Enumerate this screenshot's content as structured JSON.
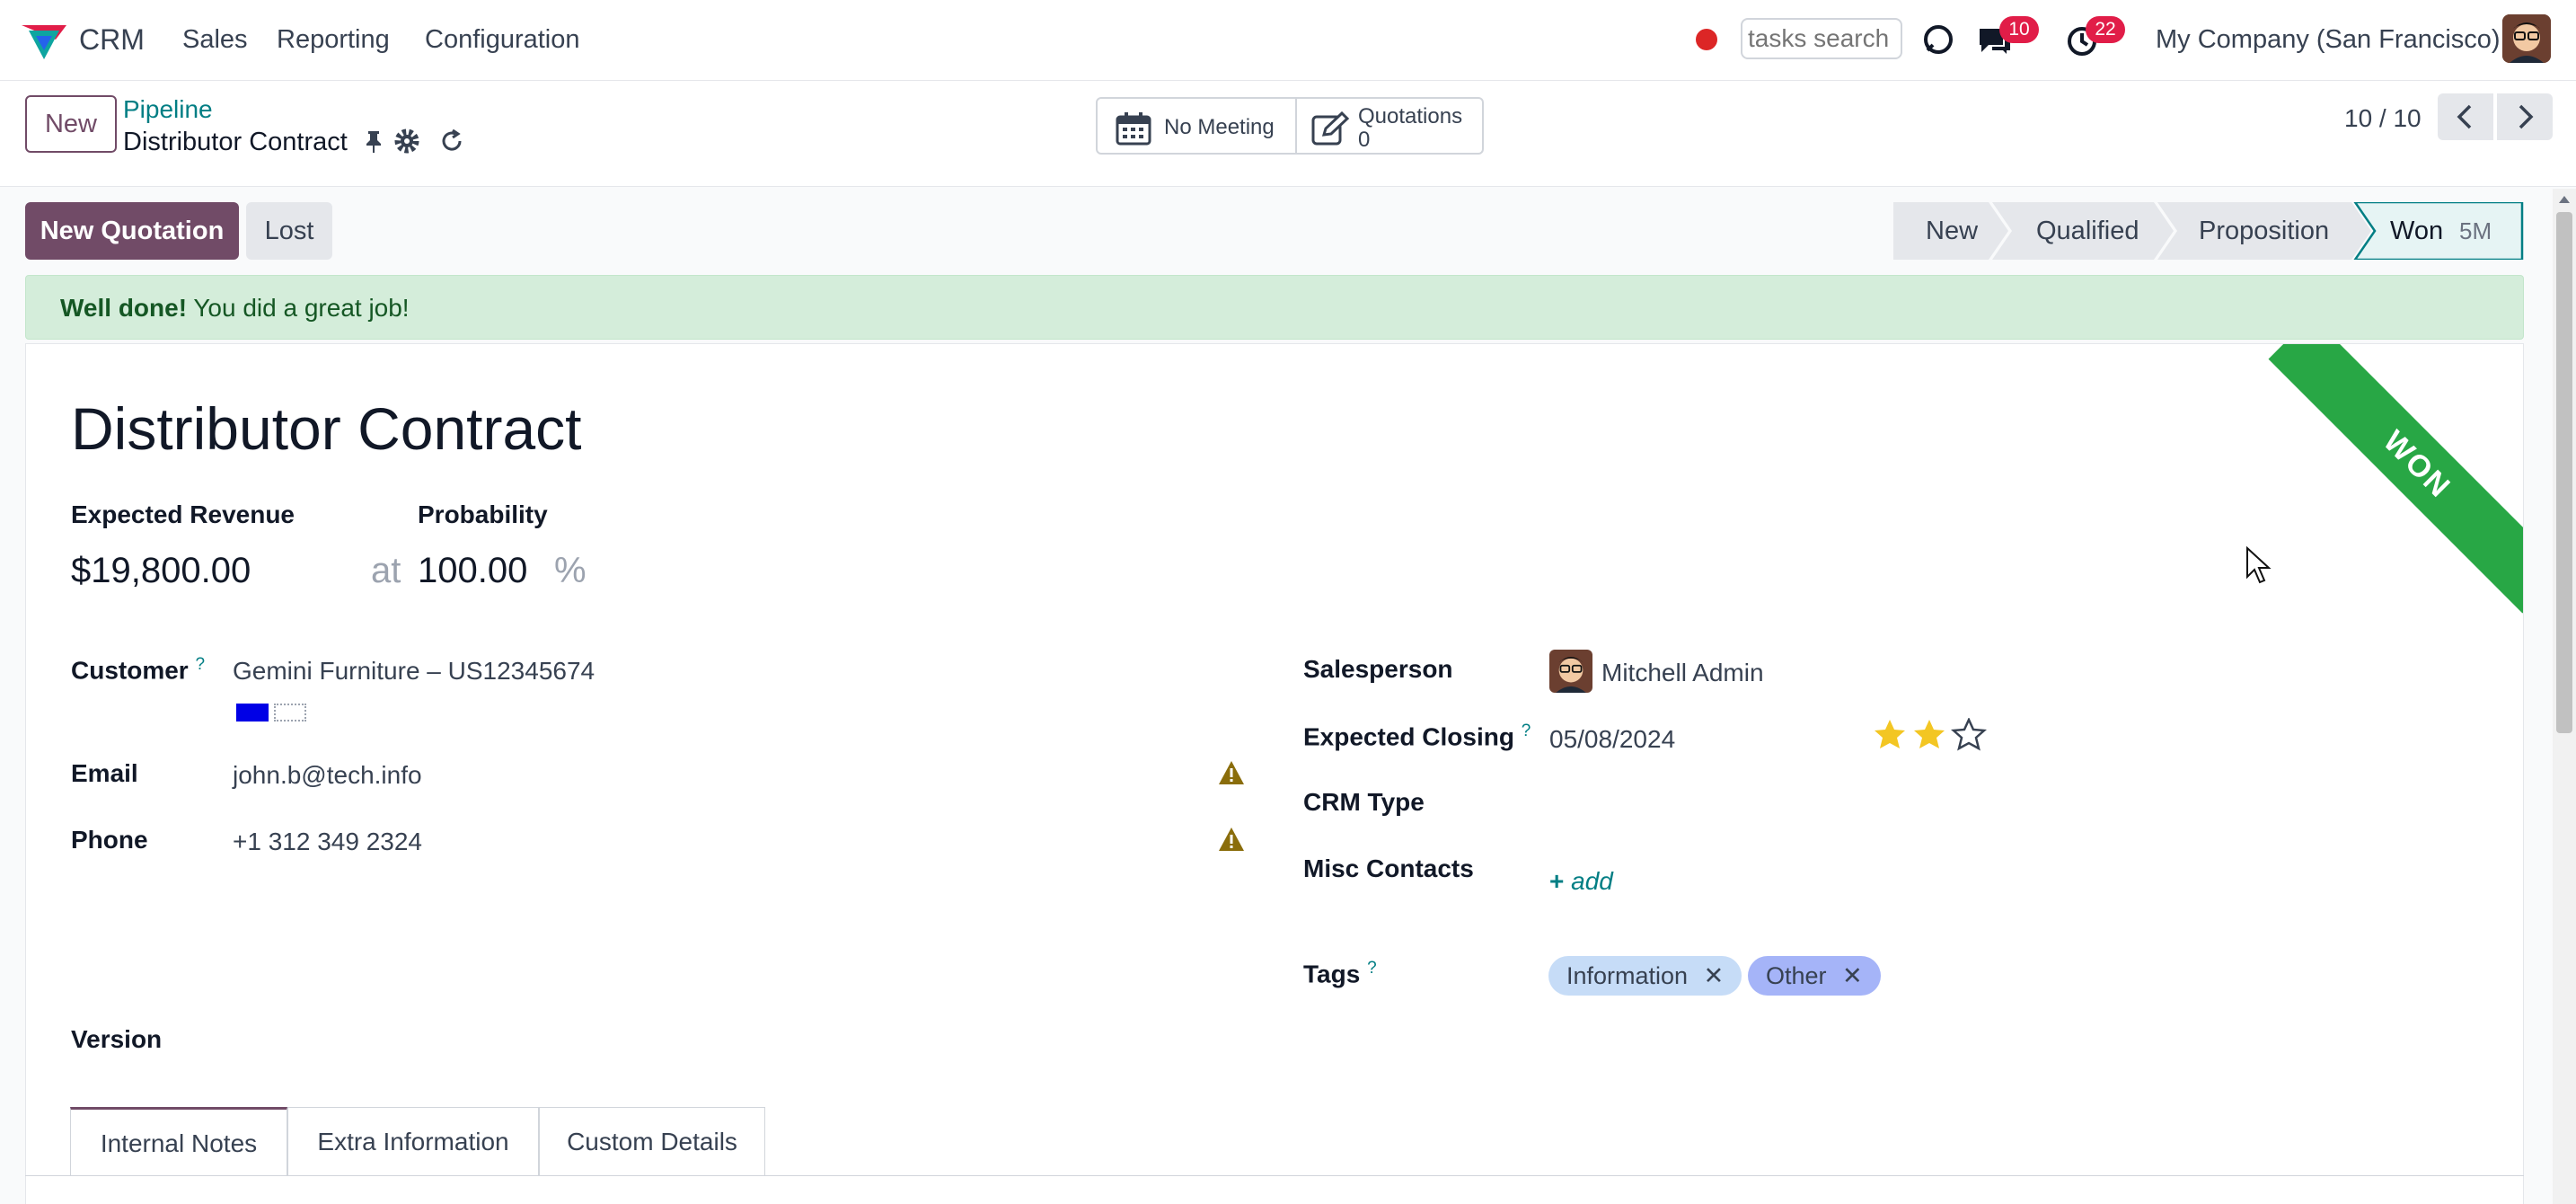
{
  "navbar": {
    "app_name": "CRM",
    "menu": [
      "Sales",
      "Reporting",
      "Configuration"
    ],
    "search_placeholder": "tasks search",
    "messages_count": "10",
    "activities_count": "22",
    "company": "My Company (San Francisco)"
  },
  "control": {
    "new_label": "New",
    "breadcrumb_parent": "Pipeline",
    "breadcrumb_current": "Distributor Contract",
    "meeting_label": "No Meeting",
    "quotations_label": "Quotations",
    "quotations_count": "0",
    "pager": "10 / 10"
  },
  "statusbar": {
    "new_quotation": "New Quotation",
    "lost": "Lost",
    "stages": [
      "New",
      "Qualified",
      "Proposition",
      "Won"
    ],
    "won_duration": "5M"
  },
  "alert": {
    "strong": "Well done!",
    "text": " You did a great job!"
  },
  "record": {
    "ribbon": "WON",
    "title": "Distributor Contract",
    "expected_revenue_label": "Expected Revenue",
    "expected_revenue": "$19,800.00",
    "at": "at",
    "probability_label": "Probability",
    "probability": "100.00",
    "percent": "%",
    "customer_label": "Customer",
    "customer": "Gemini Furniture – US12345674",
    "email_label": "Email",
    "email": "john.b@tech.info",
    "phone_label": "Phone",
    "phone": "+1 312 349 2324",
    "salesperson_label": "Salesperson",
    "salesperson": "Mitchell Admin",
    "expected_closing_label": "Expected Closing",
    "expected_closing": "05/08/2024",
    "priority_stars": 2,
    "crm_type_label": "CRM Type",
    "misc_contacts_label": "Misc Contacts",
    "add_label": "add",
    "tags_label": "Tags",
    "tags": [
      "Information",
      "Other"
    ],
    "version_label": "Version",
    "help_mark": "?"
  },
  "tabs": [
    "Internal Notes",
    "Extra Information",
    "Custom Details"
  ],
  "colors": {
    "brand": "#714b67",
    "teal": "#017e84",
    "won_ribbon": "#28a745",
    "tag_information": "#c6dcf7",
    "tag_other": "#a5b4f8",
    "badge": "#e11d48"
  }
}
